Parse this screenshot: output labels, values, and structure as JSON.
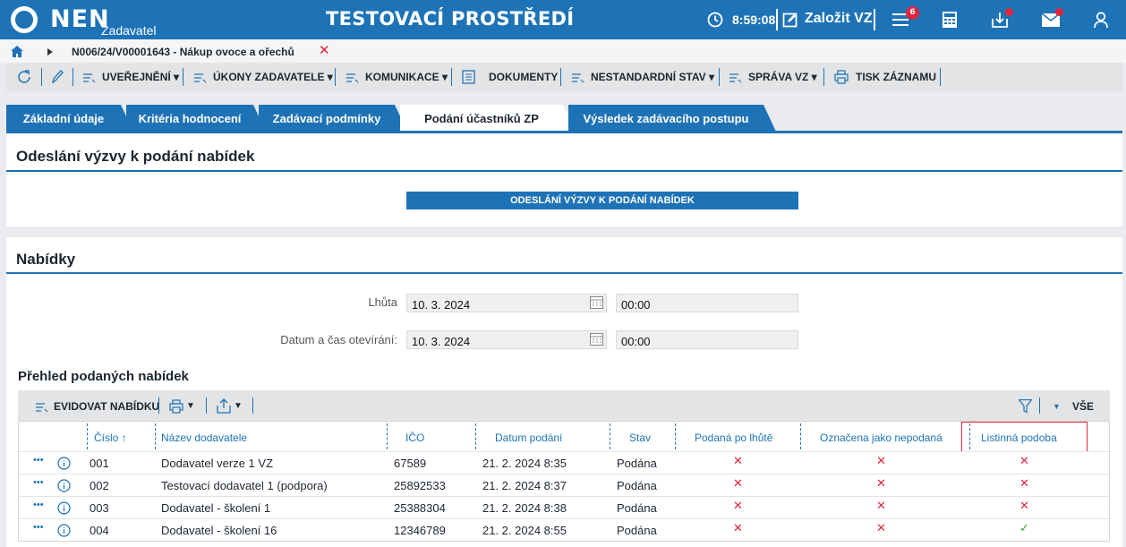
{
  "header": {
    "logo_text": "NEN",
    "logo_sub": "Zadavatel",
    "env_title": "TESTOVACÍ PROSTŘEDÍ",
    "time": "8:59:08",
    "create_label": "Založit VZ",
    "notification_count": "6"
  },
  "breadcrumb": {
    "text": "N006/24/V00001643 - Nákup ovoce a ořechů"
  },
  "toolbar": {
    "publish": "UVEŘEJNĚNÍ",
    "acts": "ÚKONY ZADAVATELE",
    "communication": "KOMUNIKACE",
    "documents": "DOKUMENTY",
    "nonstandard": "NESTANDARDNÍ STAV",
    "management": "SPRÁVA VZ",
    "print": "TISK ZÁZNAMU"
  },
  "tabs": [
    {
      "label": "Základní údaje"
    },
    {
      "label": "Kritéria hodnocení"
    },
    {
      "label": "Zadávací podmínky"
    },
    {
      "label": "Podání účastníků ZP"
    },
    {
      "label": "Výsledek zadávacího postupu"
    }
  ],
  "invite_section": {
    "title": "Odeslání výzvy k podání nabídek",
    "button": "ODESLÁNÍ VÝZVY K PODÁNÍ NABÍDEK"
  },
  "offers_section": {
    "title": "Nabídky",
    "deadline_label": "Lhůta",
    "deadline_date": "10. 3. 2024",
    "deadline_time": "00:00",
    "opening_label": "Datum a čas otevírání:",
    "opening_date": "10. 3. 2024",
    "opening_time": "00:00"
  },
  "overview": {
    "title": "Přehled podaných nabídek",
    "register_button": "EVIDOVAT NABÍDKU",
    "all_label": "VŠE",
    "columns": [
      "Číslo",
      "Název dodavatele",
      "IČO",
      "Datum podání",
      "Stav",
      "Podaná po lhůtě",
      "Označena jako nepodaná",
      "Listinná podoba"
    ],
    "rows": [
      {
        "num": "001",
        "name": "Dodavatel verze 1 VZ",
        "ico": "67589",
        "date": "21. 2. 2024 8:35",
        "status": "Podána",
        "late": "✕",
        "unsubmitted": "✕",
        "paper": "✕"
      },
      {
        "num": "002",
        "name": "Testovací dodavatel 1 (podpora)",
        "ico": "25892533",
        "date": "21. 2. 2024 8:37",
        "status": "Podána",
        "late": "✕",
        "unsubmitted": "✕",
        "paper": "✕"
      },
      {
        "num": "003",
        "name": "Dodavatel - školení 1",
        "ico": "25388304",
        "date": "21. 2. 2024 8:38",
        "status": "Podána",
        "late": "✕",
        "unsubmitted": "✕",
        "paper": "✕"
      },
      {
        "num": "004",
        "name": "Dodavatel - školení 16",
        "ico": "12346789",
        "date": "21. 2. 2024 8:55",
        "status": "Podána",
        "late": "✕",
        "unsubmitted": "✕",
        "paper": "✓"
      }
    ]
  },
  "colors": {
    "primary": "#1e73b7",
    "danger": "#e0253c",
    "success": "#2e9e4a"
  }
}
